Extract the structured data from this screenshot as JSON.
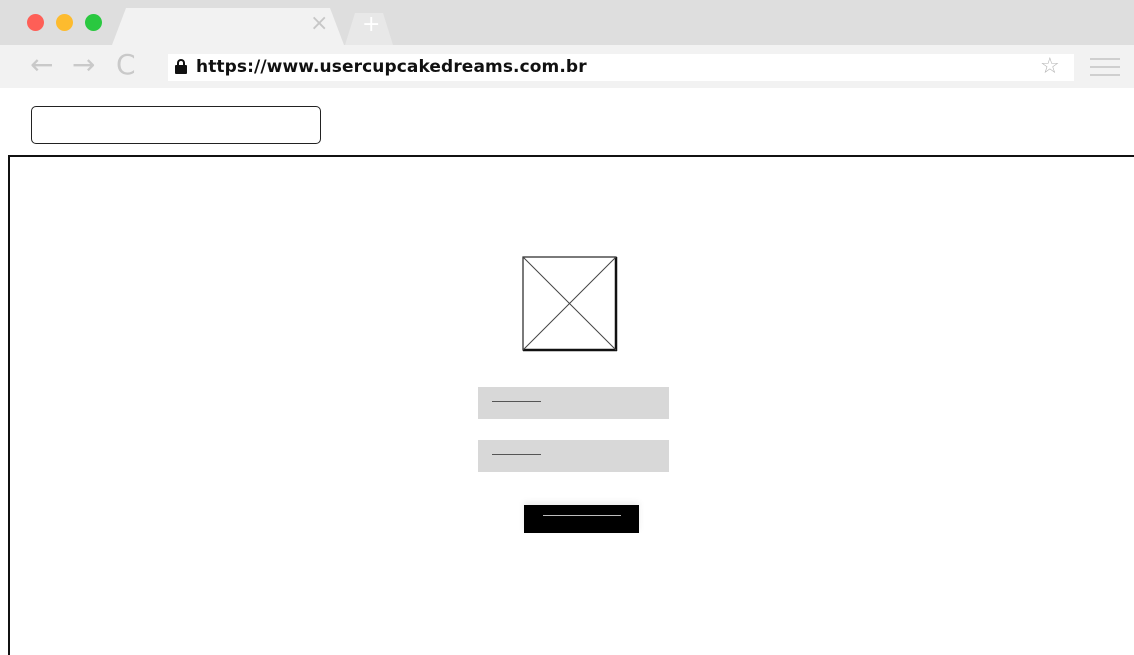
{
  "browser": {
    "url": "https://www.usercupcakedreams.com.br",
    "tab_close_glyph": "×",
    "new_tab_glyph": "+",
    "icons": {
      "back": "←",
      "forward": "→",
      "reload": "C",
      "star": "☆"
    }
  },
  "colors": {
    "traffic_red": "#fe5f57",
    "traffic_yellow": "#fdbb2e",
    "traffic_green": "#2ac840",
    "field_bg": "#d8d8d8",
    "button_bg": "#000000"
  },
  "page": {
    "search_input_value": "",
    "logo": "image-placeholder-icon",
    "fields": [
      {
        "name": "field-1",
        "value": ""
      },
      {
        "name": "field-2",
        "value": ""
      }
    ],
    "submit_label": ""
  }
}
